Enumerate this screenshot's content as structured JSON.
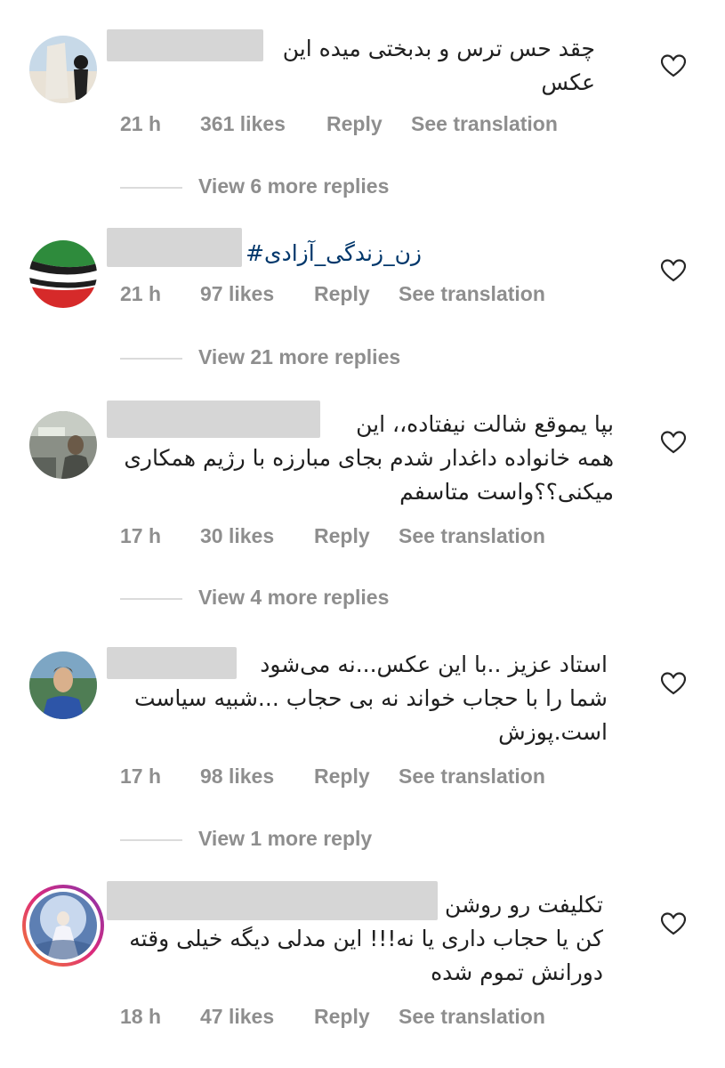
{
  "comments": [
    {
      "lines": [
        "چقد حس ترس و بدبختی میده این",
        "عکس"
      ],
      "time": "21 h",
      "likes": "361 likes",
      "reply": "Reply",
      "translate": "See translation",
      "view_replies": "View 6 more replies"
    },
    {
      "lines": [
        "زن_زندگی_آزادی#"
      ],
      "time": "21 h",
      "likes": "97 likes",
      "reply": "Reply",
      "translate": "See translation",
      "view_replies": "View 21 more replies"
    },
    {
      "lines": [
        "بپا یموقع شالت نیفتاده،، این",
        "همه خانواده داغدار شدم بجای مبارزه با رژیم همکاری",
        "میکنی؟؟واست متاسفم"
      ],
      "time": "17 h",
      "likes": "30 likes",
      "reply": "Reply",
      "translate": "See translation",
      "view_replies": "View 4 more replies"
    },
    {
      "lines": [
        "استاد عزیز ..با این عکس...نه می‌شود",
        "شما را با حجاب خواند نه بی حجاب ...شبیه سیاست",
        "است.پوزش"
      ],
      "time": "17 h",
      "likes": "98 likes",
      "reply": "Reply",
      "translate": "See translation",
      "view_replies": "View 1 more reply"
    },
    {
      "lines": [
        "تکلیفت رو روشن",
        "کن یا حجاب داری یا نه!!! این مدلی دیگه خیلی وقته",
        "دورانش تموم شده"
      ],
      "time": "18 h",
      "likes": "47 likes",
      "reply": "Reply",
      "translate": "See translation"
    }
  ],
  "colors": {
    "meta": "#8e8e8e",
    "hashtag": "#00376b",
    "story_ring_a": "#f58529",
    "story_ring_b": "#dd2a7b"
  },
  "icons": {
    "like": "heart-outline-icon"
  }
}
